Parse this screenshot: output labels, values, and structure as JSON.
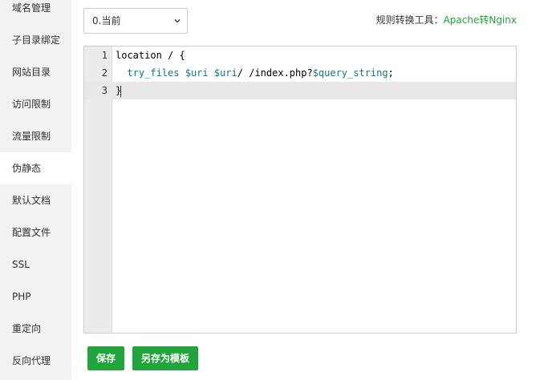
{
  "sidebar": {
    "items": [
      {
        "label": "域名管理"
      },
      {
        "label": "子目录绑定"
      },
      {
        "label": "网站目录"
      },
      {
        "label": "访问限制"
      },
      {
        "label": "流量限制"
      },
      {
        "label": "伪静态",
        "active": true
      },
      {
        "label": "默认文档"
      },
      {
        "label": "配置文件"
      },
      {
        "label": "SSL"
      },
      {
        "label": "PHP"
      },
      {
        "label": "重定向"
      },
      {
        "label": "反向代理"
      }
    ]
  },
  "template_select": {
    "value": "0.当前"
  },
  "tool": {
    "label": "规则转换工具：",
    "link": "Apache转Nginx"
  },
  "editor": {
    "lines": [
      {
        "num": "1"
      },
      {
        "num": "2"
      },
      {
        "num": "3"
      }
    ],
    "code": {
      "l1_a": "location",
      "l1_b": " / {",
      "l2_indent": "  ",
      "l2_fn": "try_files",
      "l2_sp1": " ",
      "l2_var1": "$uri",
      "l2_sp2": " ",
      "l2_var2": "$uri",
      "l2_mid": "/ /index.php?",
      "l2_var3": "$query_string",
      "l2_end": ";",
      "l3": "}"
    }
  },
  "buttons": {
    "save": "保存",
    "save_template": "另存为模板"
  },
  "colors": {
    "accent": "#20a53a",
    "sidebar_bg": "#f2f2f2",
    "gutter_bg": "#ebebeb"
  }
}
